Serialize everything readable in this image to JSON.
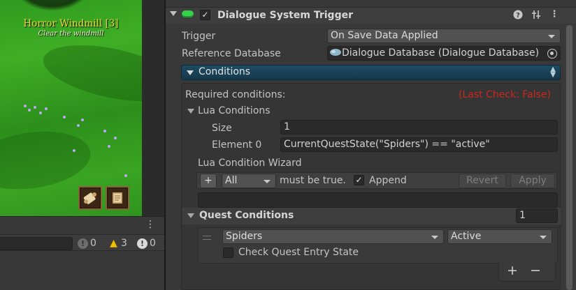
{
  "game": {
    "quest_title": "Horror Windmill [3]",
    "quest_description": "Clear the windmill",
    "slots": [
      {
        "icon": "scroll-icon"
      },
      {
        "icon": "journal-icon"
      }
    ]
  },
  "console": {
    "menu_glyph": "⋮",
    "info_count": "0",
    "warning_count": "3",
    "error_count": "0"
  },
  "component": {
    "title": "Dialogue System Trigger",
    "enabled": true,
    "header_icons": [
      "help-icon",
      "preset-icon",
      "more-icon"
    ]
  },
  "fields": {
    "trigger_label": "Trigger",
    "trigger_value": "On Save Data Applied",
    "database_label": "Reference Database",
    "database_value": "Dialogue Database (Dialogue Database)"
  },
  "conditions": {
    "label": "Conditions",
    "required_label": "Required conditions:",
    "last_check": "(Last Check: False)",
    "lua_label": "Lua Conditions",
    "size_label": "Size",
    "size_value": "1",
    "element_label": "Element 0",
    "element_value": "CurrentQuestState(\"Spiders\") == \"active\"",
    "wizard_label": "Lua Condition Wizard",
    "add_button": "+",
    "mode_value": "All",
    "must_be_true": "must be true.",
    "append_label": "Append",
    "append_checked": true,
    "revert_button": "Revert",
    "apply_button": "Apply",
    "quest_section_label": "Quest Conditions",
    "quest_count": "1",
    "quest_name": "Spiders",
    "quest_state": "Active",
    "check_entry_label": "Check Quest Entry State",
    "check_entry_checked": false,
    "list_add": "+",
    "list_remove": "−"
  },
  "colors": {
    "accent_blue": "#1d4b63",
    "script_green": "#36d14a",
    "warning_yellow": "#f0c000",
    "last_check_red": "#c8281e",
    "quest_gold": "#f2d542"
  }
}
